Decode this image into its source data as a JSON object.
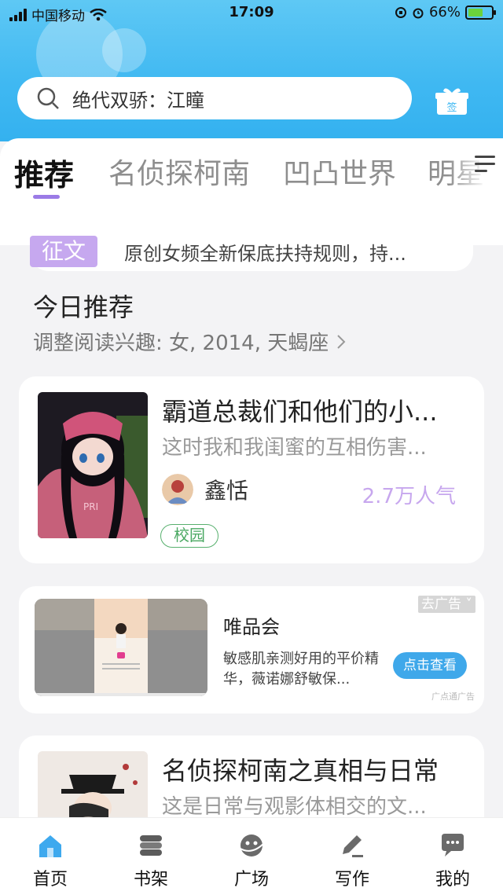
{
  "status_bar": {
    "carrier": "中国移动",
    "time": "17:09",
    "battery": "66%",
    "battery_level": 0.66
  },
  "search": {
    "query": "绝代双骄：江瞳"
  },
  "gift_label": "签",
  "tabs": [
    {
      "label": "推荐",
      "active": true
    },
    {
      "label": "名侦探柯南",
      "active": false
    },
    {
      "label": "凹凸世界",
      "active": false
    },
    {
      "label": "明星",
      "active": false
    }
  ],
  "notice": {
    "tag": "征文",
    "text": "原创女频全新保底扶持规则，持..."
  },
  "section": {
    "title": "今日推荐",
    "subtitle": "调整阅读兴趣: 女, 2014, 天蝎座"
  },
  "book1": {
    "title": "霸道总裁们和他们的小...",
    "desc": "这时我和我闺蜜的互相伤害...",
    "author": "鑫恬",
    "popularity": "2.7万人气",
    "tag": "校园"
  },
  "ad": {
    "name": "唯品会",
    "desc": "敏感肌亲测好用的平价精华，薇诺娜舒敏保...",
    "button": "点击查看",
    "close": "去广告",
    "source": "广点通广告"
  },
  "book2": {
    "title": "名侦探柯南之真相与日常",
    "desc": "这是日常与观影体相交的文..."
  },
  "bottom_nav": [
    {
      "label": "首页",
      "icon": "home-icon",
      "active": true
    },
    {
      "label": "书架",
      "icon": "bookshelf-icon",
      "active": false
    },
    {
      "label": "广场",
      "icon": "plaza-icon",
      "active": false
    },
    {
      "label": "写作",
      "icon": "pen-icon",
      "active": false
    },
    {
      "label": "我的",
      "icon": "chat-bubble-icon",
      "active": false
    }
  ],
  "colors": {
    "header_blue": "#3fb8f2",
    "accent_purple": "#9b7be6",
    "tag_green": "#4aa862",
    "nav_active": "#3fa8ea"
  }
}
